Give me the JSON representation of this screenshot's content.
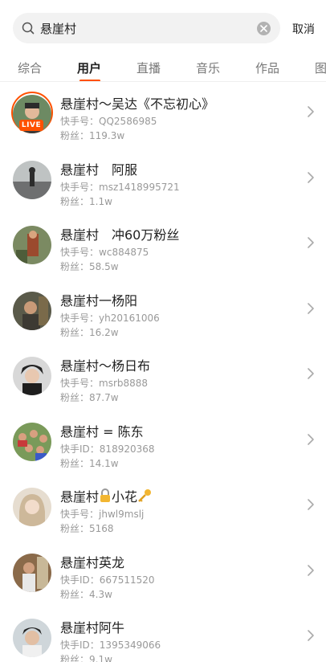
{
  "search": {
    "value": "悬崖村",
    "cancel_label": "取消"
  },
  "tabs": [
    {
      "label": "综合"
    },
    {
      "label": "用户"
    },
    {
      "label": "直播"
    },
    {
      "label": "音乐"
    },
    {
      "label": "作品"
    },
    {
      "label": "图"
    }
  ],
  "active_tab": "用户",
  "accent_color": "#ff5000",
  "users": [
    {
      "name": "悬崖村～吴达《不忘初心》",
      "id_label": "快手号",
      "id": "QQ2586985",
      "fans_label": "粉丝",
      "fans": "119.3w",
      "live": true,
      "live_label": "LIVE"
    },
    {
      "name": "悬崖村　阿服",
      "id_label": "快手号",
      "id": "msz1418995721",
      "fans_label": "粉丝",
      "fans": "1.1w"
    },
    {
      "name": "悬崖村　冲60万粉丝",
      "id_label": "快手号",
      "id": "wc884875",
      "fans_label": "粉丝",
      "fans": "58.5w"
    },
    {
      "name": "悬崖村一杨阳",
      "id_label": "快手号",
      "id": "yh20161006",
      "fans_label": "粉丝",
      "fans": "16.2w"
    },
    {
      "name": "悬崖村～杨日布",
      "id_label": "快手号",
      "id": "msrb8888",
      "fans_label": "粉丝",
      "fans": "87.7w"
    },
    {
      "name": "悬崖村 = 陈东",
      "id_label": "快手ID",
      "id": "818920368",
      "fans_label": "粉丝",
      "fans": "14.1w"
    },
    {
      "name": "悬崖村",
      "name_suffix": "小花",
      "id_label": "快手号",
      "id": "jhwl9mslj",
      "fans_label": "粉丝",
      "fans": "5168",
      "lock_icon": "lock-icon",
      "key_icon": "key-icon"
    },
    {
      "name": "悬崖村英龙",
      "id_label": "快手ID",
      "id": "667511520",
      "fans_label": "粉丝",
      "fans": "4.3w"
    },
    {
      "name": "悬崖村阿牛",
      "id_label": "快手ID",
      "id": "1395349066",
      "fans_label": "粉丝",
      "fans": "9.1w"
    }
  ]
}
